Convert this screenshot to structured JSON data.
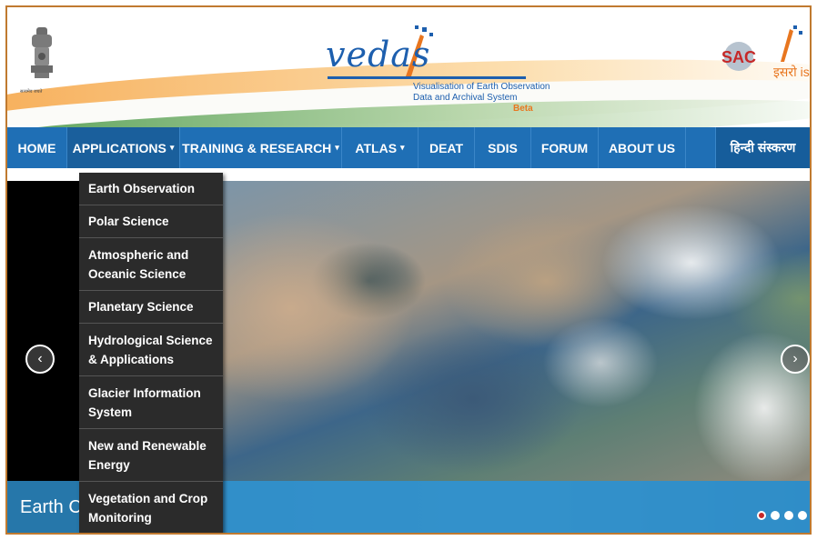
{
  "header": {
    "emblem_caption": "सत्यमेव जयते",
    "vedas_word": "vedas",
    "vedas_subtitle_line1": "Visualisation of Earth Observation",
    "vedas_subtitle_line2": "Data and Archival System",
    "vedas_beta": "Beta",
    "sac_logo": "SAC",
    "isro_text": "इसरो isro"
  },
  "nav": {
    "items": [
      {
        "label": "HOME",
        "dropdown": false
      },
      {
        "label": "APPLICATIONS",
        "dropdown": true
      },
      {
        "label": "TRAINING & RESEARCH",
        "dropdown": true
      },
      {
        "label": "ATLAS",
        "dropdown": true
      },
      {
        "label": "DEAT",
        "dropdown": false
      },
      {
        "label": "SDIS",
        "dropdown": false
      },
      {
        "label": "FORUM",
        "dropdown": false
      },
      {
        "label": "ABOUT US",
        "dropdown": false
      }
    ],
    "hindi_label": "हिन्दी संस्करण",
    "caret": "▾"
  },
  "applications_menu": {
    "items": [
      "Earth Observation",
      "Polar Science",
      "Atmospheric and\nOceanic Science",
      "Planetary Science",
      "Hydrological Science\n& Applications",
      "Glacier Information\nSystem",
      "New and Renewable\nEnergy",
      "Vegetation and Crop\nMonitoring"
    ]
  },
  "carousel": {
    "caption": "Earth C",
    "prev_icon": "chevron-left-icon",
    "next_icon": "chevron-right-icon",
    "prev_glyph": "‹",
    "next_glyph": "›",
    "slide_count": 4,
    "active_slide": 1
  },
  "colors": {
    "nav_blue": "#1f6fb5",
    "dropdown_bg": "#2b2b2b",
    "accent_orange": "#e8761f",
    "brand_blue": "#1d5fae"
  }
}
